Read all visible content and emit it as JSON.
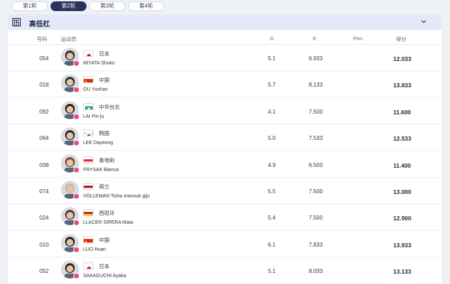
{
  "tabs": [
    "第1轮",
    "第2轮",
    "第3轮",
    "第4轮"
  ],
  "active_tab": 1,
  "header": {
    "title": "高低杠",
    "icon": "uneven-bars-icon",
    "toggle_icon": "chevron-down-icon"
  },
  "columns": {
    "bib": "号码",
    "athlete": "运动员",
    "d": "D",
    "e": "E",
    "pen": "Pen.",
    "score": "得分"
  },
  "rows": [
    {
      "bib": "054",
      "country": "日本",
      "flag": "jp",
      "name": "MIYATA Shoko",
      "d": "5.1",
      "e": "6.933",
      "score": "12.033"
    },
    {
      "bib": "018",
      "country": "中国",
      "flag": "cn",
      "name": "OU Yushan",
      "d": "5.7",
      "e": "8.133",
      "score": "13.833"
    },
    {
      "bib": "092",
      "country": "中华台北",
      "flag": "tpe",
      "name": "LAI Pin-ju",
      "d": "4.1",
      "e": "7.500",
      "score": "11.600"
    },
    {
      "bib": "064",
      "country": "韩国",
      "flag": "kr",
      "name": "LEE Dayeong",
      "d": "5.0",
      "e": "7.533",
      "score": "12.533"
    },
    {
      "bib": "008",
      "country": "奥地利",
      "flag": "at",
      "name": "FRYSAK Bianca",
      "d": "4.9",
      "e": "6.500",
      "score": "11.400"
    },
    {
      "bib": "074",
      "country": "荷兰",
      "flag": "nl",
      "name": "VOLLEMAN Tisha manouk gijs",
      "d": "5.5",
      "e": "7.500",
      "score": "13.000"
    },
    {
      "bib": "024",
      "country": "西班牙",
      "flag": "es",
      "name": "LLACER SIRERA Maia",
      "d": "5.4",
      "e": "7.500",
      "score": "12.900"
    },
    {
      "bib": "010",
      "country": "中国",
      "flag": "cn",
      "name": "LUO Huan",
      "d": "6.1",
      "e": "7.833",
      "score": "13.933"
    },
    {
      "bib": "052",
      "country": "日本",
      "flag": "jp",
      "name": "SAKAGUCHI Ayaka",
      "d": "5.1",
      "e": "8.033",
      "score": "13.133"
    }
  ],
  "colors": {
    "accent": "#26335f",
    "header_bg": "#e3e9f6",
    "badge": "#e84a7f"
  }
}
